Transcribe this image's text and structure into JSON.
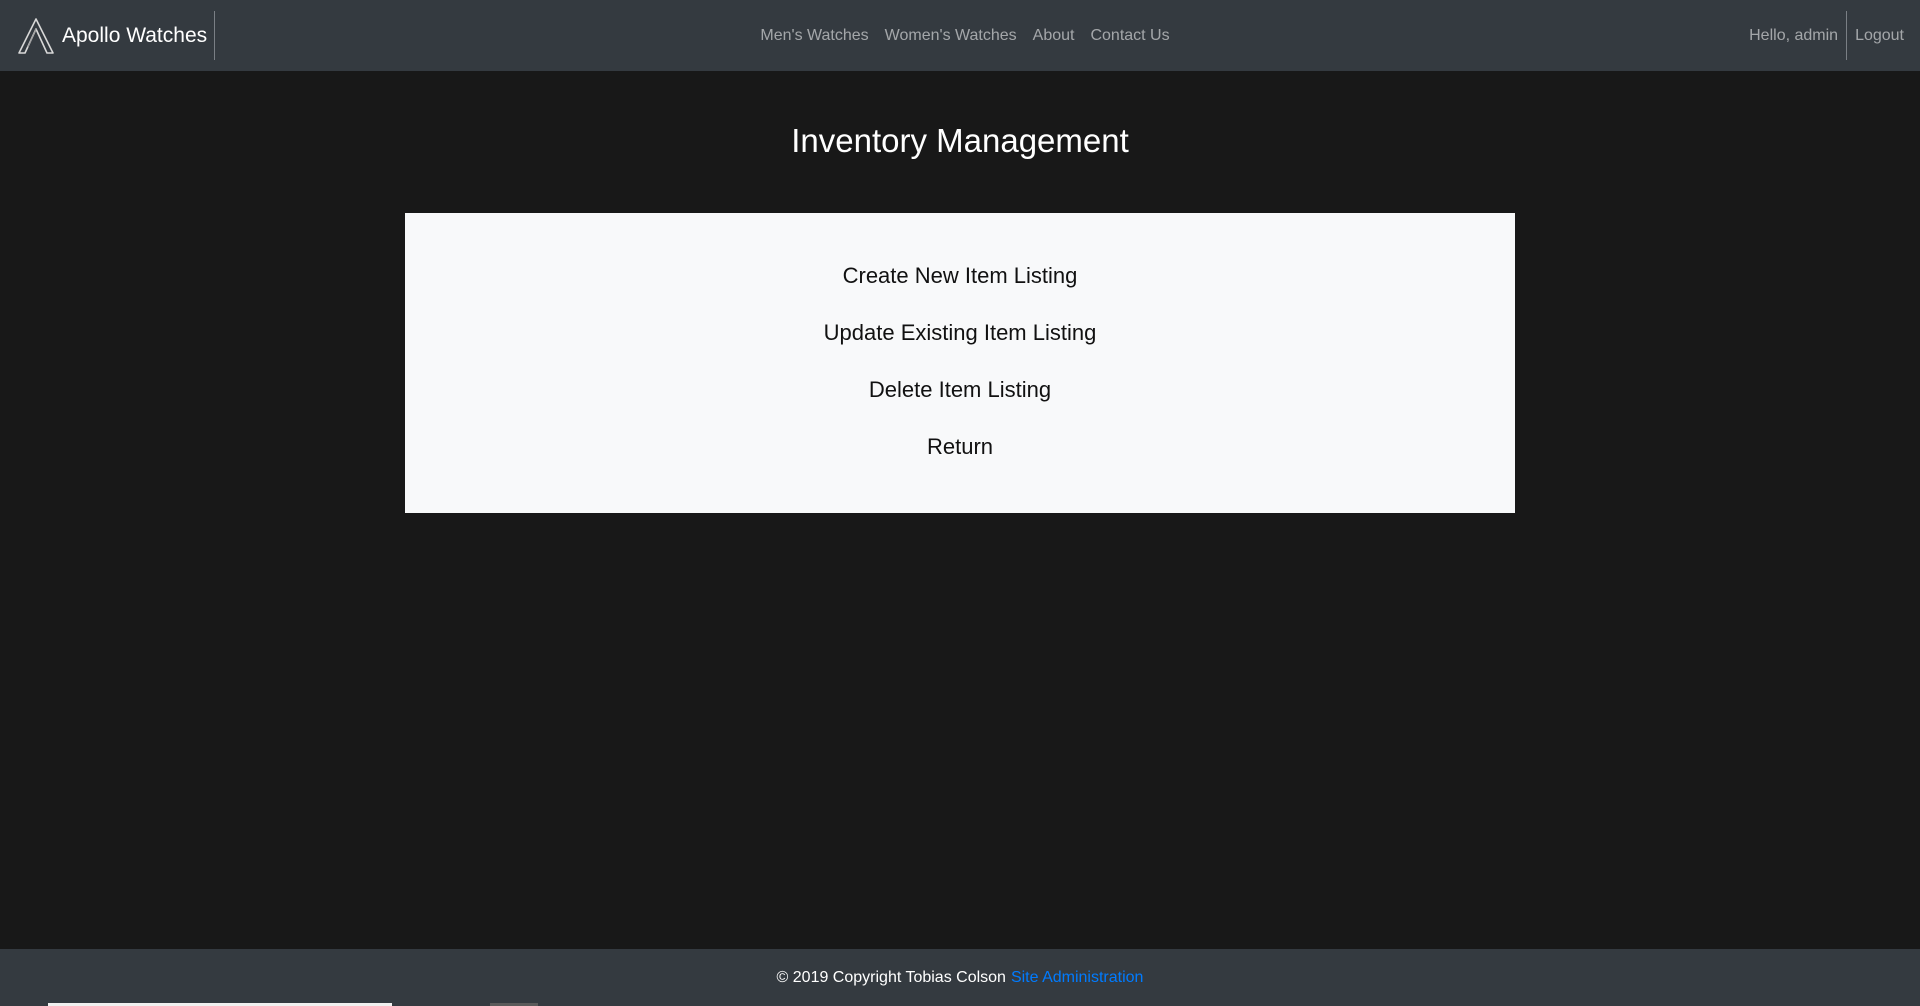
{
  "header": {
    "brand_name": "Apollo Watches",
    "logo_icon": "apollo-a-logo-icon",
    "nav_links": [
      {
        "label": "Men's Watches"
      },
      {
        "label": "Women's Watches"
      },
      {
        "label": "About"
      },
      {
        "label": "Contact Us"
      }
    ],
    "greeting": "Hello, admin",
    "logout_label": "Logout",
    "background_color": "#343a40"
  },
  "main": {
    "title": "Inventory Management",
    "menu": [
      {
        "label": "Create New Item Listing"
      },
      {
        "label": "Update Existing Item Listing"
      },
      {
        "label": "Delete Item Listing"
      },
      {
        "label": "Return"
      }
    ],
    "page_background": "#181818",
    "panel_background": "#f8f9fa"
  },
  "footer": {
    "copyright": "© 2019 Copyright Tobias Colson",
    "admin_link": "Site Administration",
    "link_color": "#007bff"
  }
}
